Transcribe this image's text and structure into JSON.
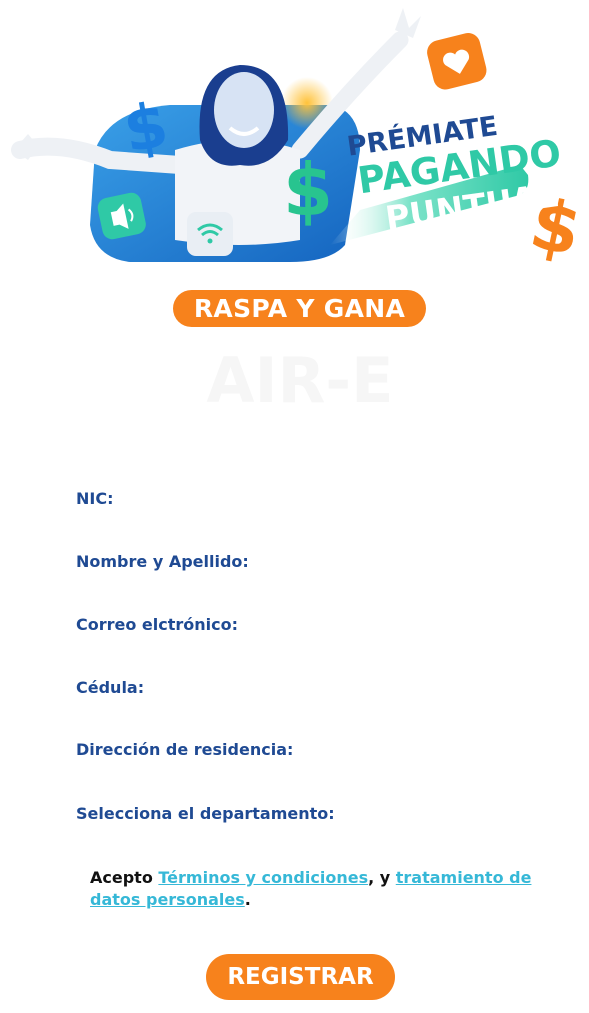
{
  "hero": {
    "title_line1": "PRÉMIATE",
    "title_line2": "PAGANDO",
    "title_line3": "PUNTUAL"
  },
  "badge": {
    "label": "RASPA Y GANA"
  },
  "ghost_text": "AIR-E",
  "form": {
    "fields": [
      {
        "label": "NIC:"
      },
      {
        "label": "Nombre y Apellido:"
      },
      {
        "label": "Correo elctrónico:"
      },
      {
        "label": "Cédula:"
      },
      {
        "label": "Dirección de residencia:"
      },
      {
        "label": "Selecciona el departamento:"
      }
    ],
    "consent": {
      "prefix": "Acepto ",
      "terms_link": "Términos y condiciones",
      "middle": ", y ",
      "privacy_link": "tratamiento de datos personales",
      "suffix": "."
    },
    "submit_label": "REGISTRAR"
  },
  "colors": {
    "orange": "#f7821c",
    "label_blue": "#1f4a93",
    "link_cyan": "#36b8d7",
    "title_blue": "#1f4a93",
    "title_green": "#2fc9a6"
  }
}
